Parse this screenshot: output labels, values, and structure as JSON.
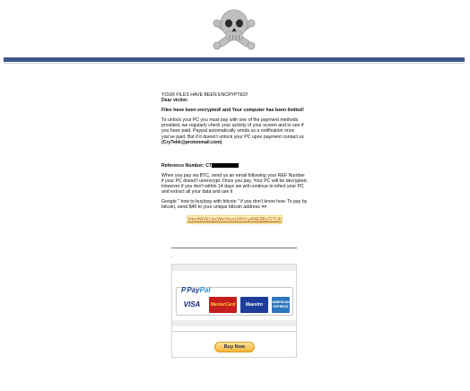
{
  "header": {
    "logo_icon": "skull-crossbones-icon",
    "accent_color": "#3b5a8a"
  },
  "note": {
    "title": "YOUR FILES HAVE BEEN ENCRYPTED!",
    "greeting": "Dear victim:",
    "headline": "Files have been encrypted! and Your computer has been limited!",
    "instructions": "To unlock your PC you must pay with one of the payment methods provided, we regularly check your activity of your screen and to see if you have paid. Paypal automatically sends us a notification once you've paid. But if it doesn't unlock your PC upon payment contact us",
    "contact": "(CryTekk@protonmail.com)",
    "reference_label": "Reference Number: CT",
    "btc_text": "When you pay via BTC, send us an email following your REF Number if your PC doesn't unencrypt. Once you pay, Your PC will be decrypted. However if you don't within 14 days we will continue to infect your PC and extract all your data and use it",
    "google_text": "Google \" how to buy/pay with bitcoin \" if you don't know how. To pay by bitcoin, send $40 to your unique bitcoin address",
    "arrow": ">>",
    "btc_address": "34ooNtVEUpcWeVbuxUWXcyANE88y22TUb"
  },
  "payment": {
    "dot": ".",
    "paypal_mark": "P",
    "paypal_word_1": "Pay",
    "paypal_word_2": "Pal",
    "card_visa": "VISA",
    "card_mastercard": "MasterCard",
    "card_maestro": "Maestro",
    "card_amex": "AMERICAN EXPRESS",
    "buy_button": "Buy Now"
  }
}
